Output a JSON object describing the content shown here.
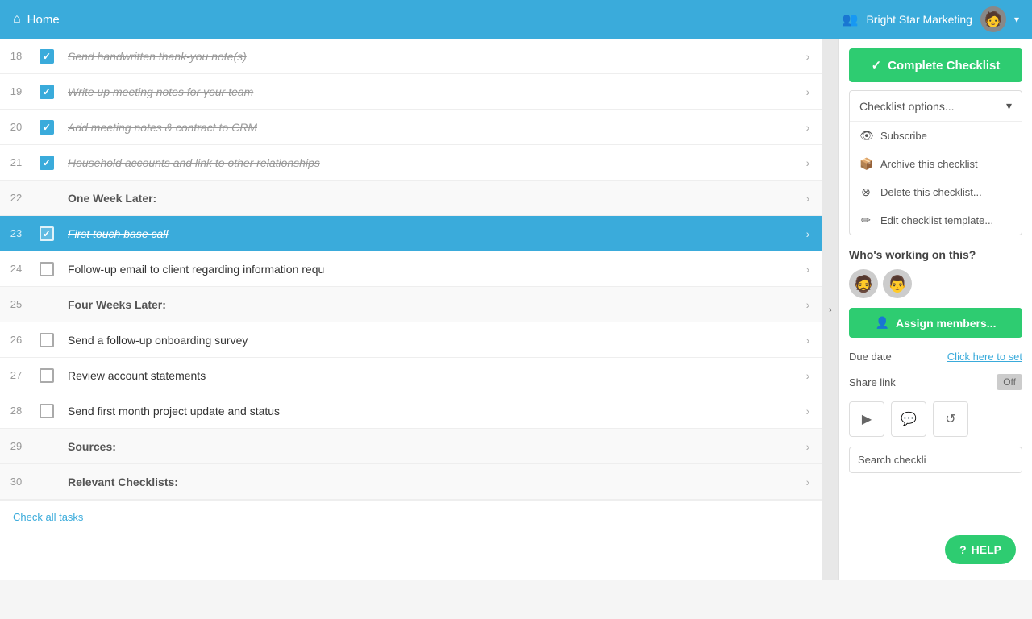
{
  "topnav": {
    "home_label": "Home",
    "org_name": "Bright Star Marketing",
    "dropdown_arrow": "▾"
  },
  "sidebar_right": {
    "complete_label": "Complete Checklist",
    "options_label": "Checklist options...",
    "subscribe_label": "Subscribe",
    "archive_label": "Archive this checklist",
    "delete_label": "Delete this checklist...",
    "edit_template_label": "Edit checklist template...",
    "who_working_label": "Who's working on this?",
    "assign_label": "Assign members...",
    "due_date_label": "Due date",
    "due_date_link": "Click here to set",
    "share_label": "Share link",
    "toggle_label": "Off",
    "search_placeholder": "Search checklist...",
    "search_value": "Search checkli"
  },
  "checklist": {
    "items": [
      {
        "num": "18",
        "checked": true,
        "text": "Send handwritten thank-you note(s)",
        "strikethrough": true,
        "highlighted": false,
        "is_section": false
      },
      {
        "num": "19",
        "checked": true,
        "text": "Write up meeting notes for your team",
        "strikethrough": true,
        "highlighted": false,
        "is_section": false
      },
      {
        "num": "20",
        "checked": true,
        "text": "Add meeting notes & contract to CRM",
        "strikethrough": true,
        "highlighted": false,
        "is_section": false
      },
      {
        "num": "21",
        "checked": true,
        "text": "Household accounts and link to other relationships",
        "strikethrough": true,
        "highlighted": false,
        "is_section": false
      },
      {
        "num": "22",
        "checked": false,
        "text": "One Week Later:",
        "strikethrough": false,
        "highlighted": false,
        "is_section": true
      },
      {
        "num": "23",
        "checked": true,
        "text": "First touch base call",
        "strikethrough": true,
        "highlighted": true,
        "is_section": false
      },
      {
        "num": "24",
        "checked": false,
        "text": "Follow-up email to client regarding information requ",
        "strikethrough": false,
        "highlighted": false,
        "is_section": false
      },
      {
        "num": "25",
        "checked": false,
        "text": "Four Weeks Later:",
        "strikethrough": false,
        "highlighted": false,
        "is_section": true
      },
      {
        "num": "26",
        "checked": false,
        "text": "Send a follow-up onboarding survey",
        "strikethrough": false,
        "highlighted": false,
        "is_section": false
      },
      {
        "num": "27",
        "checked": false,
        "text": "Review account statements",
        "strikethrough": false,
        "highlighted": false,
        "is_section": false
      },
      {
        "num": "28",
        "checked": false,
        "text": "Send first month project update and status",
        "strikethrough": false,
        "highlighted": false,
        "is_section": false
      },
      {
        "num": "29",
        "checked": false,
        "text": "Sources:",
        "strikethrough": false,
        "highlighted": false,
        "is_section": true
      },
      {
        "num": "30",
        "checked": false,
        "text": "Relevant Checklists:",
        "strikethrough": false,
        "highlighted": false,
        "is_section": true
      }
    ],
    "check_all_label": "Check all tasks"
  },
  "icons": {
    "home": "⌂",
    "org": "👥",
    "check": "✓",
    "arrow_right": "›",
    "chevron_down": "▾",
    "chevron_right": "›",
    "collapse": "›",
    "subscribe": "👁",
    "archive": "📦",
    "delete": "⊗",
    "edit": "✏",
    "assign": "👤",
    "play": "▶",
    "comment": "💬",
    "refresh": "↺",
    "help": "?",
    "search": "🔍"
  },
  "help_label": "HELP"
}
